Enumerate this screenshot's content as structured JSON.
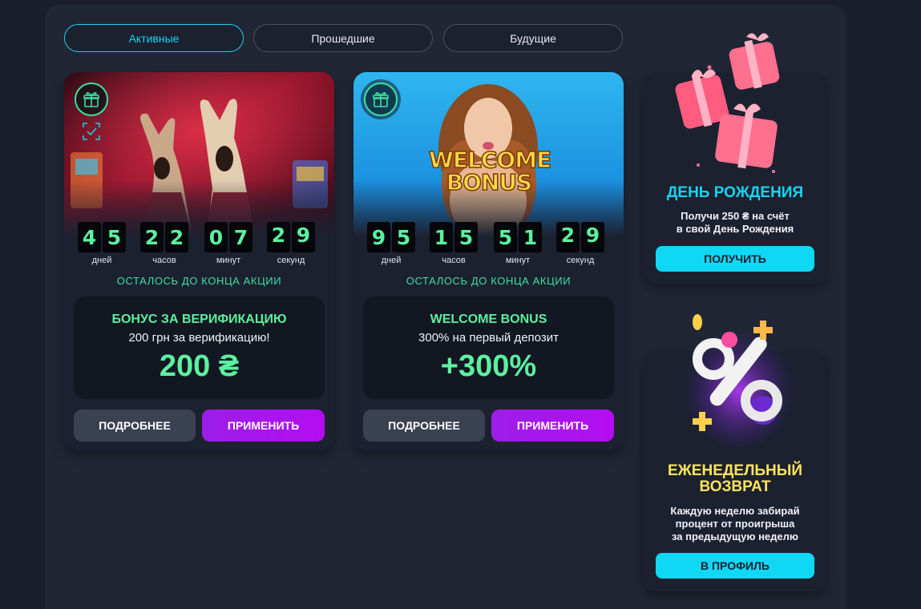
{
  "tabs": [
    "Активные",
    "Прошедшие",
    "Будущие"
  ],
  "timer_labels": [
    "дней",
    "часов",
    "минут",
    "секунд"
  ],
  "promos": [
    {
      "banner_kind": "llamas",
      "timer": [
        [
          "4",
          "5"
        ],
        [
          "2",
          "2"
        ],
        [
          "0",
          "7"
        ],
        [
          "2",
          "9"
        ]
      ],
      "ends_label": "ОСТАЛОСЬ ДО КОНЦА АКЦИИ",
      "title": "БОНУС ЗА ВЕРИФИКАЦИЮ",
      "subtitle": "200 грн за верификацию!",
      "value": "200 ₴",
      "more_label": "ПОДРОБНЕЕ",
      "apply_label": "ПРИМЕНИТЬ"
    },
    {
      "banner_kind": "welcome",
      "banner_text_1": "WELCOME",
      "banner_text_2": "BONUS",
      "timer": [
        [
          "9",
          "5"
        ],
        [
          "1",
          "5"
        ],
        [
          "5",
          "1"
        ],
        [
          "2",
          "9"
        ]
      ],
      "ends_label": "ОСТАЛОСЬ ДО КОНЦА АКЦИИ",
      "title": "WELCOME BONUS",
      "subtitle": "300% на первый депозит",
      "value": "+300%",
      "more_label": "ПОДРОБНЕЕ",
      "apply_label": "ПРИМЕНИТЬ"
    }
  ],
  "birthday": {
    "title": "ДЕНЬ РОЖДЕНИЯ",
    "desc_line1": "Получи 250 ₴ на счёт",
    "desc_line2": "в свой День Рождения",
    "button": "ПОЛУЧИТЬ",
    "title_color": "#19d3f0"
  },
  "weekly": {
    "title_line1": "ЕЖЕНЕДЕЛЬНЫЙ",
    "title_line2": "ВОЗВРАТ",
    "desc_line1": "Каждую неделю забирай",
    "desc_line2": "процент от проигрыша",
    "desc_line3": "за предыдущую неделю",
    "button": "В ПРОФИЛЬ",
    "title_color": "#ffe45c"
  },
  "colors": {
    "accent_cyan": "#19d3f0",
    "accent_green": "#5cf0a0",
    "accent_purple": "#a414ee"
  },
  "icons": [
    "gift-icon",
    "scan-icon"
  ]
}
